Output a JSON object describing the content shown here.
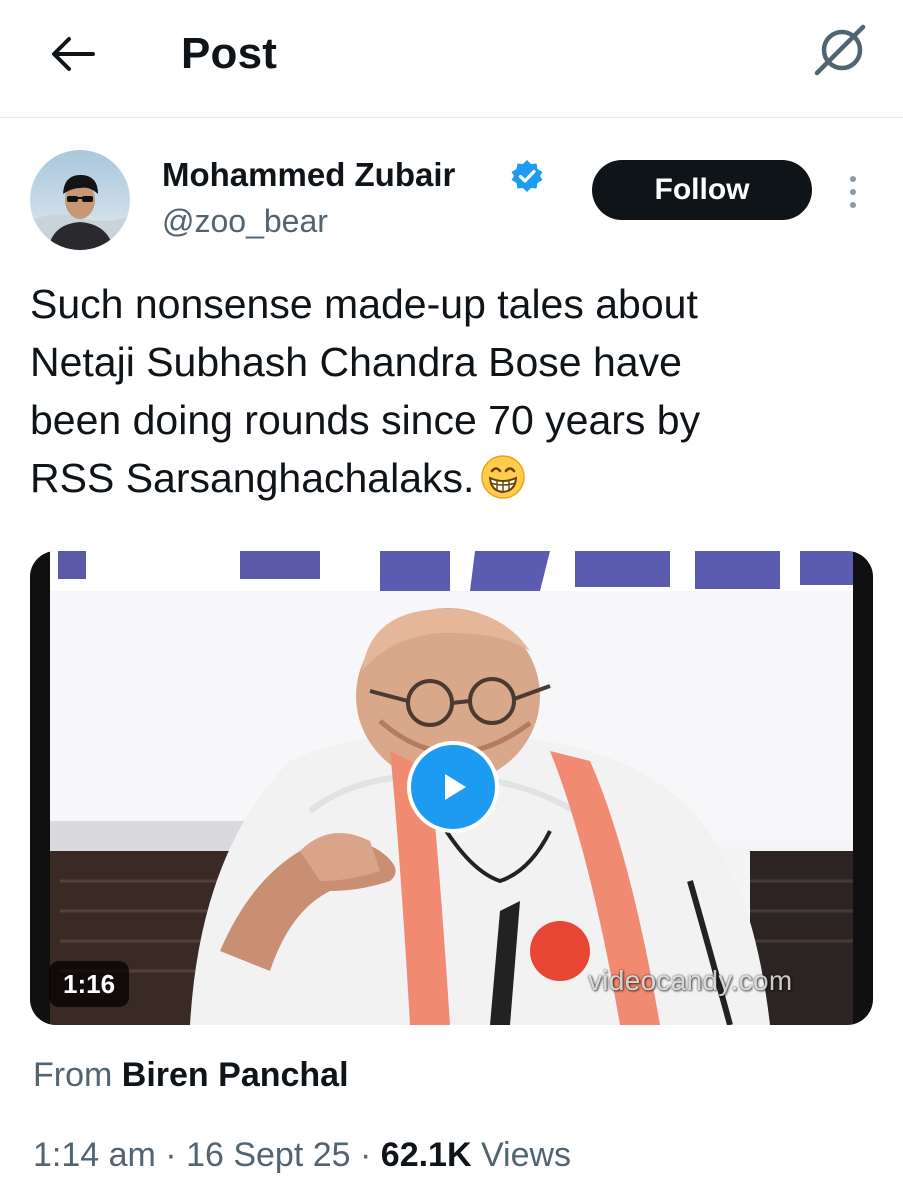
{
  "header": {
    "title": "Post",
    "back_icon": "arrow-left-icon",
    "grok_icon": "grok-icon"
  },
  "author": {
    "display_name": "Mohammed Zubair",
    "handle": "@zoo_bear",
    "verified": true,
    "verified_color": "#1d9bf0",
    "follow_label": "Follow"
  },
  "tweet": {
    "text": "Such nonsense made-up tales about\nNetaji Subhash Chandra Bose have\nbeen doing rounds since 70 years by\nRSS Sarsanghachalaks.",
    "emoji": "grinning-face-icon"
  },
  "media": {
    "duration": "1:16",
    "watermark": "videocandy.com",
    "play_color": "#1d9bf0"
  },
  "source": {
    "prefix": "From",
    "name": "Biren Panchal"
  },
  "meta": {
    "time": "1:14 am",
    "separator": " · ",
    "date": "16 Sept 25",
    "views_count": "62.1K",
    "views_label": "Views"
  }
}
